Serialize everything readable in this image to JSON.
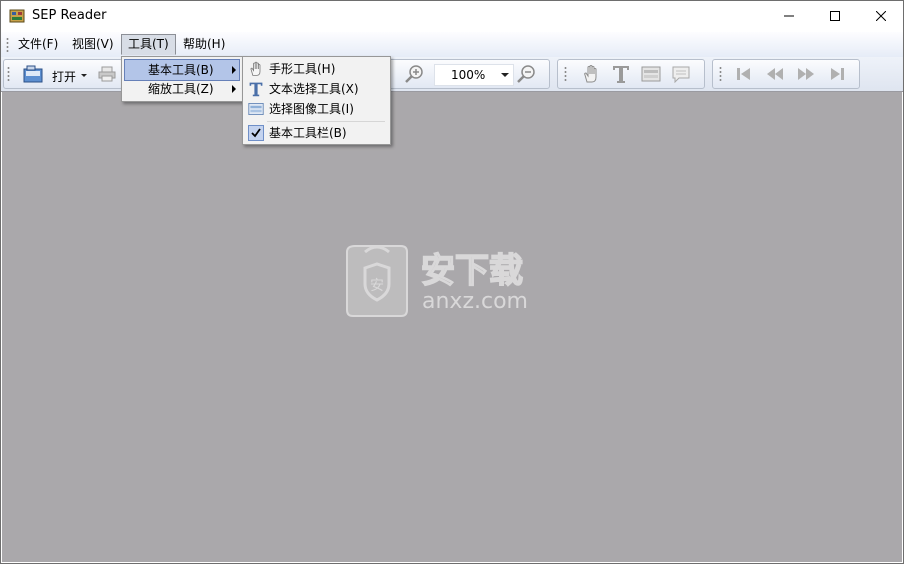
{
  "window": {
    "title": "SEP Reader",
    "controls": {
      "minimize": "minimize-icon",
      "maximize": "maximize-icon",
      "close": "close-icon"
    }
  },
  "menubar": {
    "items": [
      {
        "label": "文件(F)",
        "accel": "F"
      },
      {
        "label": "视图(V)",
        "accel": "V"
      },
      {
        "label": "工具(T)",
        "accel": "T",
        "open": true
      },
      {
        "label": "帮助(H)",
        "accel": "H"
      }
    ]
  },
  "tools_menu": {
    "items": [
      {
        "label": "基本工具(B)",
        "highlighted": true,
        "has_submenu": true
      },
      {
        "label": "缩放工具(Z)",
        "has_submenu": true
      }
    ]
  },
  "basic_tools_submenu": {
    "items": [
      {
        "label": "手形工具(H)",
        "icon": "hand-icon"
      },
      {
        "label": "文本选择工具(X)",
        "icon": "text-select-icon"
      },
      {
        "label": "选择图像工具(I)",
        "icon": "image-select-icon"
      },
      {
        "label": "基本工具栏(B)",
        "checked": true
      }
    ]
  },
  "toolbar": {
    "open_label": "打开",
    "zoom_value": "100%",
    "buttons": [
      "open-file-icon",
      "print-icon",
      "zoom-in-icon",
      "zoom-out-icon",
      "hand-icon",
      "text-select-icon",
      "image-select-icon",
      "comment-icon",
      "first-page-icon",
      "previous-page-icon",
      "next-page-icon",
      "last-page-icon"
    ]
  },
  "watermark": {
    "text": "anxz.com"
  },
  "colors": {
    "document_background": "#aaa8ab",
    "menu_highlight": "#b3c5e8",
    "menubar_gradient_bottom": "#e6ecf7"
  }
}
